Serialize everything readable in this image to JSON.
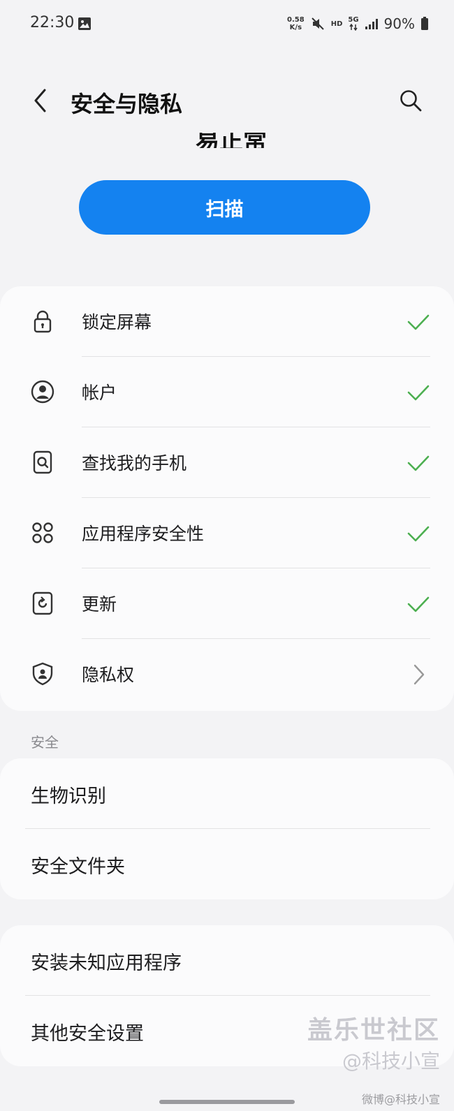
{
  "status_bar": {
    "time": "22:30",
    "net_speed_value": "0.58",
    "net_speed_unit": "K/s",
    "hd": "HD",
    "network": "5G",
    "battery": "90%",
    "icons": [
      "gallery-icon",
      "mute-icon",
      "data-arrows-icon",
      "signal-icon",
      "battery-icon"
    ]
  },
  "header": {
    "title": "安全与隐私",
    "back_icon": "back-arrow-icon",
    "search_icon": "search-icon"
  },
  "clipped_text": "易正常",
  "scan_button": {
    "label": "扫描"
  },
  "status_items": [
    {
      "label": "锁定屏幕",
      "icon": "lock-icon",
      "status": "check"
    },
    {
      "label": "帐户",
      "icon": "account-icon",
      "status": "check"
    },
    {
      "label": "查找我的手机",
      "icon": "find-phone-icon",
      "status": "check"
    },
    {
      "label": "应用程序安全性",
      "icon": "apps-icon",
      "status": "check"
    },
    {
      "label": "更新",
      "icon": "update-icon",
      "status": "check"
    },
    {
      "label": "隐私权",
      "icon": "privacy-shield-icon",
      "status": "chevron"
    }
  ],
  "security_section": {
    "title": "安全",
    "items": [
      {
        "label": "生物识别"
      },
      {
        "label": "安全文件夹"
      }
    ]
  },
  "other_items": [
    {
      "label": "安装未知应用程序"
    },
    {
      "label": "其他安全设置"
    }
  ],
  "watermark": {
    "main": "盖乐世社区",
    "sub": "@科技小宣",
    "small": "微博@科技小宣"
  },
  "colors": {
    "accent": "#1482f0",
    "check": "#4caf50",
    "background": "#f3f3f5",
    "card": "#fbfbfc"
  }
}
